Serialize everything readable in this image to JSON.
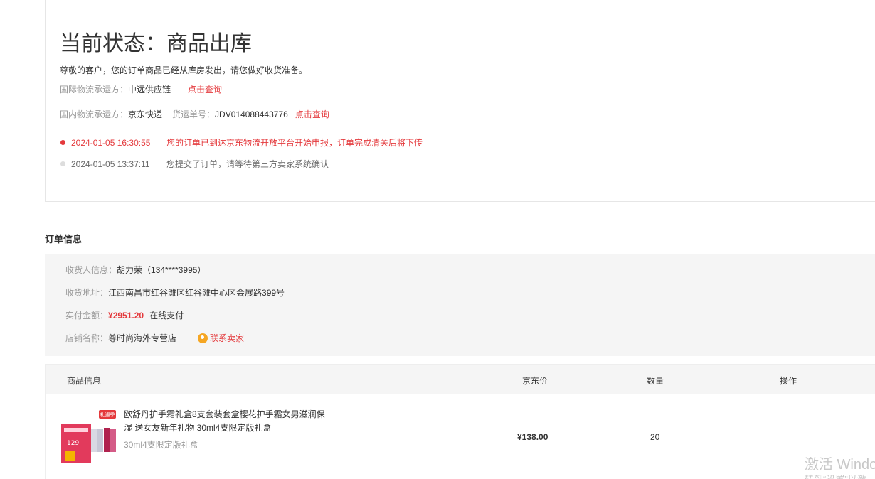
{
  "status": {
    "title": "当前状态：商品出库",
    "description": "尊敬的客户，您的订单商品已经从库房发出，请您做好收货准备。",
    "intl_label": "国际物流承运方：",
    "intl_carrier": "中远供应链",
    "intl_query": "点击查询",
    "domestic_label": "国内物流承运方：",
    "domestic_carrier": "京东快递",
    "waybill_label": "货运单号：",
    "waybill_no": "JDV014088443776",
    "domestic_query": "点击查询",
    "tracking": [
      {
        "time": "2024-01-05 16:30:55",
        "text": "您的订单已到达京东物流开放平台开始申报，订单完成清关后将下传"
      },
      {
        "time": "2024-01-05 13:37:11",
        "text": "您提交了订单，请等待第三方卖家系统确认"
      }
    ]
  },
  "order_info": {
    "section_title": "订单信息",
    "receiver_label": "收货人信息：",
    "receiver_value": "胡力荣（134****3995）",
    "address_label": "收货地址：",
    "address_value": "江西南昌市红谷滩区红谷滩中心区会展路399号",
    "amount_label": "实付金额：",
    "amount_value": "¥2951.20",
    "payment_method": "在线支付",
    "shop_label": "店铺名称：",
    "shop_value": "尊时尚海外专营店",
    "contact_seller": "联系卖家"
  },
  "goods": {
    "headers": {
      "info": "商品信息",
      "price": "京东价",
      "qty": "数量",
      "op": "操作"
    },
    "items": [
      {
        "name": "欧舒丹护手霜礼盒8支套装套盒樱花护手霜女男滋润保湿 送女友新年礼物 30ml4支限定版礼盒",
        "spec": "30ml4支限定版礼盒",
        "price": "¥138.00",
        "qty": "20",
        "badge": "礼遇季",
        "thumb_price": "129"
      }
    ]
  },
  "watermark": {
    "line1": "激活 Windo",
    "line2": "转到“设置”以激"
  },
  "colors": {
    "accent": "#e4393c",
    "panel_bg": "#f5f5f5",
    "contact_icon": "#f5a623"
  }
}
